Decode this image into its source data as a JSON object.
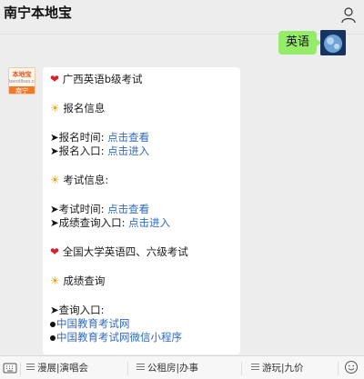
{
  "header": {
    "title": "南宁本地宝"
  },
  "sent": {
    "text": "英语"
  },
  "oa_avatar": {
    "brand": "本地宝",
    "domain": "bendibao.com",
    "city": "南宁"
  },
  "message": {
    "cet_title": "广西英语b级考试",
    "reg_info": "报名信息",
    "reg_time_label": "报名时间:",
    "reg_time_link": "点击查看",
    "reg_entry_label": "报名入口:",
    "reg_entry_link": "点击进入",
    "exam_info": "考试信息:",
    "exam_time_label": "考试时间:",
    "exam_time_link": "点击查看",
    "score_entry_label": "成绩查询入口:",
    "score_entry_link": "点击进入",
    "cet46_title": "全国大学英语四、六级考试",
    "score_query": "成绩查询",
    "query_entry_label": "查询入口:",
    "link_neea": "中国教育考试网",
    "link_neea_mini": "中国教育考试网微信小程序"
  },
  "menu": {
    "item1": "漫展|演唱会",
    "item2": "公租房|办事",
    "item3": "游玩|九价"
  }
}
